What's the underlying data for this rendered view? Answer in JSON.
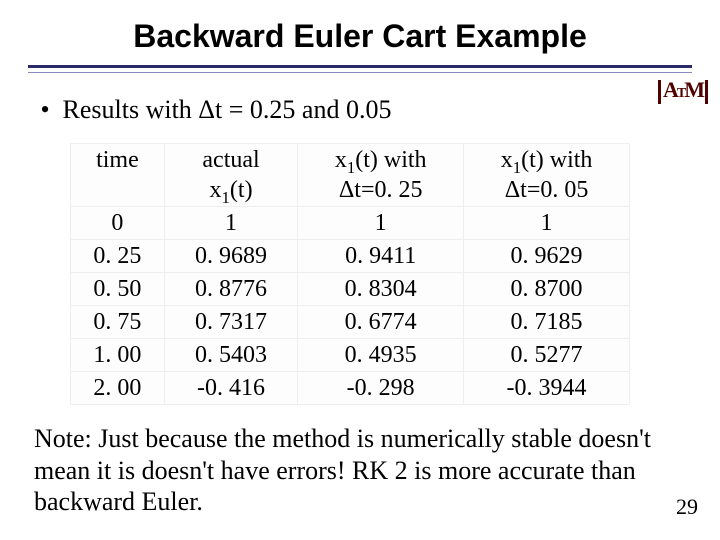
{
  "title": "Backward Euler Cart Example",
  "logo_name": "texas-am-logo",
  "bullet": {
    "text_before": "Results with ",
    "delta": "Δ",
    "text_mid": "t = 0.25 and 0.05"
  },
  "table": {
    "headers": {
      "c0": "time",
      "c1_line1": "actual",
      "c1_line2_pre": "x",
      "c1_line2_sub": "1",
      "c1_line2_post": "(t)",
      "c2_line1_pre": "x",
      "c2_line1_sub": "1",
      "c2_line1_post": "(t) with",
      "c2_line2": "Δt=0. 25",
      "c3_line1_pre": "x",
      "c3_line1_sub": "1",
      "c3_line1_post": "(t) with",
      "c3_line2": "Δt=0. 05"
    },
    "rows": [
      {
        "time": "0",
        "actual": "1",
        "dt025": "1",
        "dt005": "1"
      },
      {
        "time": "0. 25",
        "actual": "0. 9689",
        "dt025": "0. 9411",
        "dt005": "0. 9629"
      },
      {
        "time": "0. 50",
        "actual": "0. 8776",
        "dt025": "0. 8304",
        "dt005": "0. 8700"
      },
      {
        "time": "0. 75",
        "actual": "0. 7317",
        "dt025": "0. 6774",
        "dt005": "0. 7185"
      },
      {
        "time": "1. 00",
        "actual": "0. 5403",
        "dt025": "0. 4935",
        "dt005": "0. 5277"
      },
      {
        "time": "2. 00",
        "actual": "-0. 416",
        "dt025": "-0. 298",
        "dt005": "-0. 3944"
      }
    ]
  },
  "note": "Note: Just because the method is numerically stable doesn't mean it is doesn't have errors!  RK 2 is more accurate than backward Euler.",
  "page_number": "29"
}
